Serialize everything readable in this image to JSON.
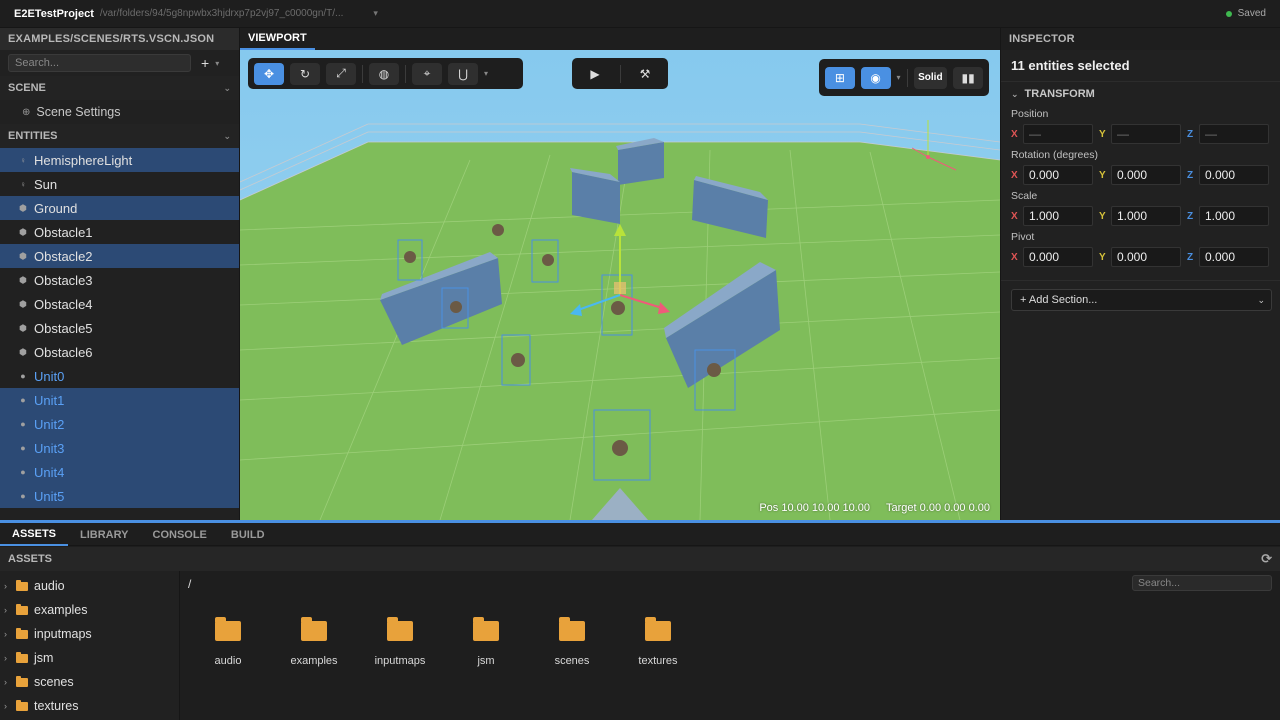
{
  "titlebar": {
    "project": "E2ETestProject",
    "path": "/var/folders/94/5g8npwbx3hjdrxp7p2vj97_c0000gn/T/...",
    "status": "Saved"
  },
  "left": {
    "title": "EXAMPLES/SCENES/RTS.VSCN.JSON",
    "search_placeholder": "Search...",
    "scene_header": "SCENE",
    "scene_settings": "Scene Settings",
    "entities_header": "ENTITIES",
    "entities": [
      {
        "name": "HemisphereLight",
        "icon": "light-icon",
        "selected": true,
        "unit": false
      },
      {
        "name": "Sun",
        "icon": "light-icon",
        "selected": false,
        "unit": false
      },
      {
        "name": "Ground",
        "icon": "cube-icon",
        "selected": true,
        "unit": false
      },
      {
        "name": "Obstacle1",
        "icon": "cube-icon",
        "selected": false,
        "unit": false
      },
      {
        "name": "Obstacle2",
        "icon": "cube-icon",
        "selected": true,
        "unit": false
      },
      {
        "name": "Obstacle3",
        "icon": "cube-icon",
        "selected": false,
        "unit": false
      },
      {
        "name": "Obstacle4",
        "icon": "cube-icon",
        "selected": false,
        "unit": false
      },
      {
        "name": "Obstacle5",
        "icon": "cube-icon",
        "selected": false,
        "unit": false
      },
      {
        "name": "Obstacle6",
        "icon": "cube-icon",
        "selected": false,
        "unit": false
      },
      {
        "name": "Unit0",
        "icon": "circle-icon",
        "selected": false,
        "unit": true
      },
      {
        "name": "Unit1",
        "icon": "circle-icon",
        "selected": true,
        "unit": true
      },
      {
        "name": "Unit2",
        "icon": "circle-icon",
        "selected": true,
        "unit": true
      },
      {
        "name": "Unit3",
        "icon": "circle-icon",
        "selected": true,
        "unit": true
      },
      {
        "name": "Unit4",
        "icon": "circle-icon",
        "selected": true,
        "unit": true
      },
      {
        "name": "Unit5",
        "icon": "circle-icon",
        "selected": true,
        "unit": true
      }
    ]
  },
  "viewport": {
    "tab": "VIEWPORT",
    "solid_label": "Solid",
    "pos_readout": "Pos 10.00 10.00 10.00",
    "target_readout": "Target 0.00 0.00 0.00"
  },
  "inspector": {
    "header": "INSPECTOR",
    "title": "11 entities selected",
    "transform_header": "TRANSFORM",
    "position_label": "Position",
    "position": {
      "x": "—",
      "y": "—",
      "z": "—"
    },
    "rotation_label": "Rotation (degrees)",
    "rotation": {
      "x": "0.000",
      "y": "0.000",
      "z": "0.000"
    },
    "scale_label": "Scale",
    "scale": {
      "x": "1.000",
      "y": "1.000",
      "z": "1.000"
    },
    "pivot_label": "Pivot",
    "pivot": {
      "x": "0.000",
      "y": "0.000",
      "z": "0.000"
    },
    "axis_labels": {
      "x": "X",
      "y": "Y",
      "z": "Z"
    },
    "add_section": "+ Add Section..."
  },
  "bottom": {
    "tabs": [
      "ASSETS",
      "LIBRARY",
      "CONSOLE",
      "BUILD"
    ],
    "assets_header": "ASSETS",
    "tree": [
      "audio",
      "examples",
      "inputmaps",
      "jsm",
      "scenes",
      "textures"
    ],
    "crumb": "/",
    "search_placeholder": "Search...",
    "files": [
      "audio",
      "examples",
      "inputmaps",
      "jsm",
      "scenes",
      "textures"
    ]
  },
  "colors": {
    "accent": "#4a90e2",
    "selection": "#2c4a75",
    "unit_text": "#5aa0f5",
    "folder": "#e8a23b",
    "saved_dot": "#3fb950"
  }
}
